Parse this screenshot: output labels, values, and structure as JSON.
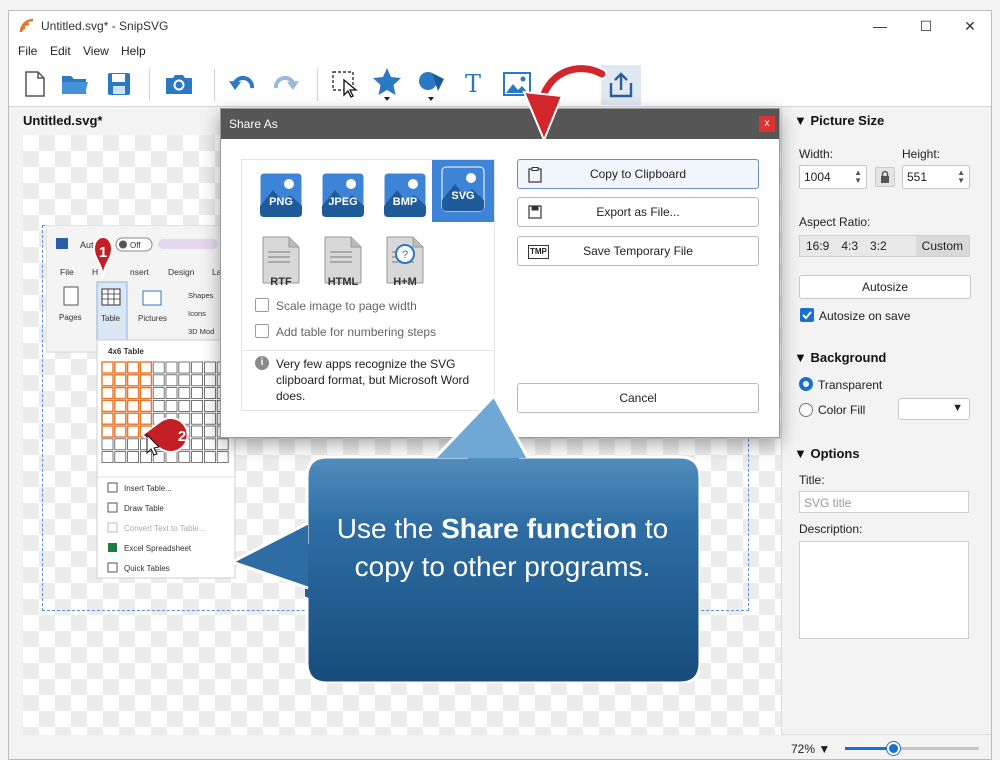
{
  "window": {
    "title": "Untitled.svg* - SnipSVG",
    "controls": {
      "minimize": "—",
      "maximize": "☐",
      "close": "✕"
    }
  },
  "menu": [
    "File",
    "Edit",
    "View",
    "Help"
  ],
  "toolbar": {
    "icons": [
      "new-file-icon",
      "open-folder-icon",
      "save-icon",
      "camera-icon",
      "undo-icon",
      "redo-icon",
      "select-icon",
      "star-shape-icon",
      "shapes-icon",
      "text-icon",
      "image-icon",
      "share-icon"
    ],
    "text_tool": "T"
  },
  "canvas": {
    "document_title": "Untitled.svg*"
  },
  "embedded_screenshot": {
    "autosave": "AutoSa",
    "off": "Off",
    "tabs": [
      "File",
      "H",
      "nsert",
      "Design",
      "La"
    ],
    "ribbon": {
      "pages": "Pages",
      "table": "Table",
      "pictures": "Pictures",
      "shapes": "Shapes",
      "icons": "Icons",
      "models": "3D Mod"
    },
    "grid_label": "4x6 Table",
    "grid": {
      "cols": 10,
      "rows": 8,
      "highlight_cols": 4,
      "highlight_rows": 6
    },
    "menu_items": [
      "Insert Table...",
      "Draw Table",
      "Convert Text to Table...",
      "Excel Spreadsheet",
      "Quick Tables"
    ],
    "callouts": [
      "1",
      "2"
    ]
  },
  "dialog": {
    "title": "Share As",
    "close": "x",
    "formats": [
      {
        "label": "PNG",
        "selected": false
      },
      {
        "label": "JPEG",
        "selected": false
      },
      {
        "label": "BMP",
        "selected": false
      },
      {
        "label": "SVG",
        "selected": true
      },
      {
        "label": "RTF",
        "selected": false
      },
      {
        "label": "HTML",
        "selected": false
      },
      {
        "label": "H+M",
        "selected": false
      }
    ],
    "options": [
      "Scale image to page width",
      "Add table for numbering steps"
    ],
    "info": "Very few apps recognize the SVG clipboard format, but Microsoft Word does.",
    "buttons": {
      "copy": "Copy to Clipboard",
      "export": "Export as File...",
      "temp": "Save Temporary File",
      "cancel": "Cancel"
    },
    "temp_icon_text": "TMP"
  },
  "callout": {
    "prefix": "Use the ",
    "bold": "Share function",
    "suffix": " to copy to other programs."
  },
  "panel": {
    "picture_size": {
      "heading": "Picture Size",
      "width_label": "Width:",
      "width": "1004",
      "height_label": "Height:",
      "height": "551",
      "aspect_label": "Aspect Ratio:",
      "aspects": [
        "16:9",
        "4:3",
        "3:2",
        "Custom"
      ],
      "autosize": "Autosize",
      "autosize_on_save": "Autosize on save"
    },
    "background": {
      "heading": "Background",
      "transparent": "Transparent",
      "color_fill": "Color Fill"
    },
    "options": {
      "heading": "Options",
      "title_label": "Title:",
      "title_placeholder": "SVG title",
      "description_label": "Description:"
    }
  },
  "status": {
    "zoom": "72%",
    "zoom_fraction": 0.36
  },
  "colors": {
    "accent": "#1a6fd1",
    "callout": "#1f5f93",
    "arrow": "#d3262c",
    "selected_format": "#3d84d6"
  }
}
